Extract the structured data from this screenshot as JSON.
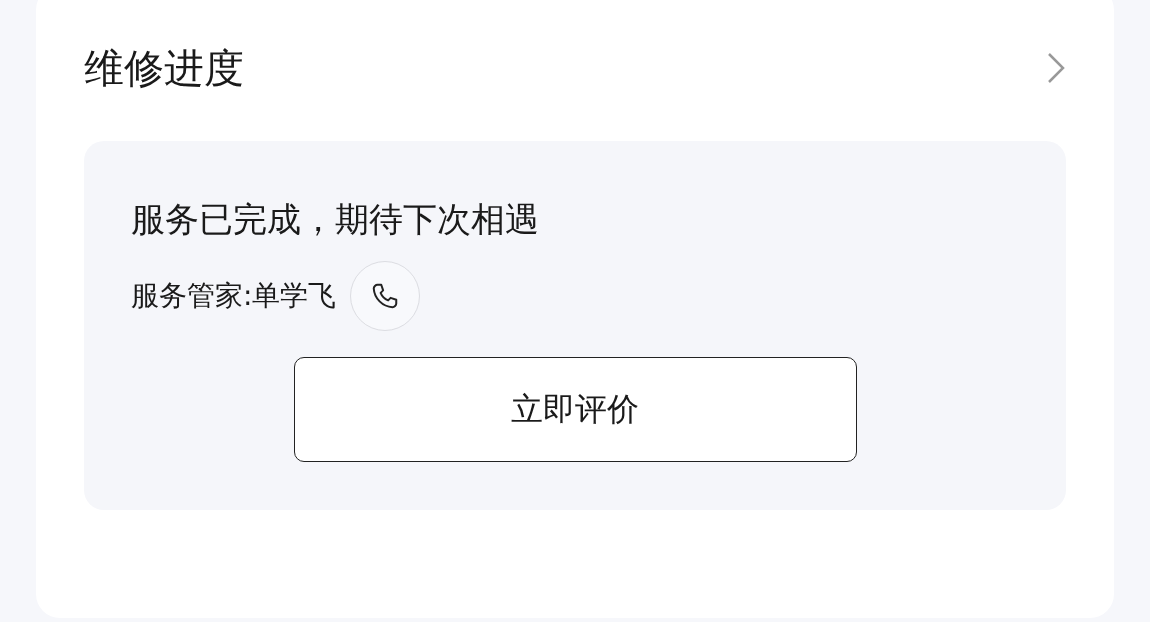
{
  "card": {
    "title": "维修进度"
  },
  "progress": {
    "status": "服务已完成，期待下次相遇",
    "manager": "服务管家:单学飞",
    "button": "立即评价"
  }
}
